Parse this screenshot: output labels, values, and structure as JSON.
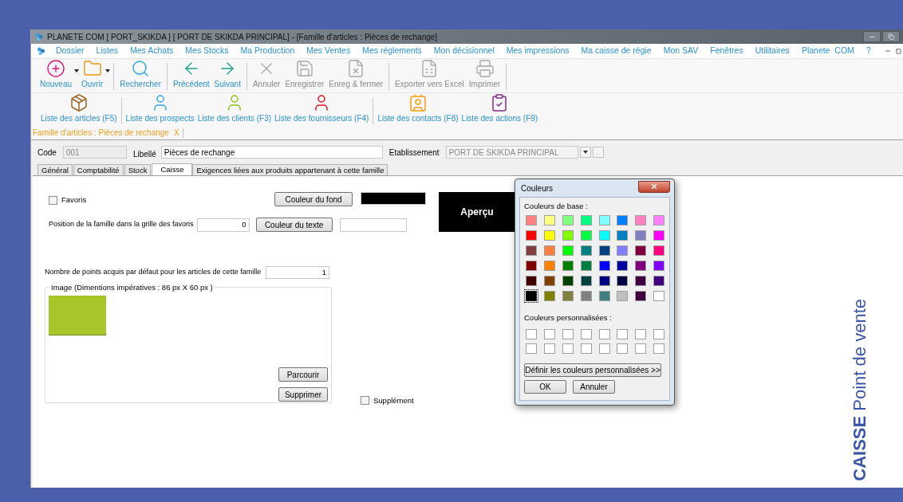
{
  "window": {
    "title": "PLANETE COM [ PORT_SKIKDA ] [ PORT DE SKIKDA PRINCIPAL] - [Famille d'articles : Pièces de rechange]"
  },
  "menu": [
    "Dossier",
    "Listes",
    "Mes Achats",
    "Mes Stocks",
    "Ma Production",
    "Mes Ventes",
    "Mes réglements",
    "Mon décisionnel",
    "Mes impressions",
    "Ma caisse de régie",
    "Mon SAV",
    "Fenêtres",
    "Utilitaires",
    "Planete  COM",
    "?"
  ],
  "toolbar": [
    {
      "label": "Nouveau",
      "disabled": false,
      "dropdown": true
    },
    {
      "label": "Ouvrir",
      "disabled": false,
      "dropdown": true
    },
    {
      "label": "Rechercher",
      "disabled": false,
      "dropdown": false
    },
    {
      "label": "Précédent",
      "disabled": false,
      "dropdown": false
    },
    {
      "label": "Suivant",
      "disabled": false,
      "dropdown": false
    },
    {
      "label": "Annuler",
      "disabled": true,
      "dropdown": false
    },
    {
      "label": "Enregistrer",
      "disabled": true,
      "dropdown": false
    },
    {
      "label": "Enreg & fermer",
      "disabled": true,
      "dropdown": false
    },
    {
      "label": "Exporter vers Excel",
      "disabled": true,
      "dropdown": false
    },
    {
      "label": "Imprimer",
      "disabled": true,
      "dropdown": false
    }
  ],
  "quick_links": [
    "Liste des articles (F5)",
    "Liste des prospects",
    "Liste des clients (F3)",
    "Liste des fournisseurs (F4)",
    "Liste des contacts (F8)",
    "Liste des actions (F9)"
  ],
  "document_tab": {
    "label": "Famille d'articles : Pièces de rechange",
    "close": "X"
  },
  "header": {
    "code": {
      "label": "Code",
      "value": "001",
      "disabled": true
    },
    "libelle": {
      "label": "Libellé",
      "value": "Pièces de rechange"
    },
    "etablissement": {
      "label": "Etablissement",
      "value": "PORT DE SKIKDA PRINCIPAL",
      "disabled": true,
      "browse": ".."
    }
  },
  "tabs": [
    {
      "label": "Général",
      "selected": false
    },
    {
      "label": "Comptabilité",
      "selected": false
    },
    {
      "label": "Stock",
      "selected": false
    },
    {
      "label": "Caisse",
      "selected": true
    },
    {
      "label": "Exigences liées aux produits appartenant à cette famille",
      "selected": false
    }
  ],
  "caisse": {
    "favoris": {
      "label": "Favoris",
      "checked": false
    },
    "position": {
      "label": "Position de la famille dans la grille des favoris",
      "value": "0"
    },
    "background": {
      "button": "Couleur du fond",
      "color": "#000000"
    },
    "text": {
      "button": "Couleur du texte",
      "color": "#ffffff"
    },
    "preview": "Aperçu",
    "points": {
      "label": "Nombre de points acquis par défaut pour les articles de cette famille",
      "value": "1"
    },
    "image": {
      "title": "Image (Dimentions impératives : 86 px X 60 px )",
      "color": "#a8c62a",
      "browse": "Parcourir",
      "delete": "Supprimer"
    },
    "supplement": {
      "label": "Supplément",
      "checked": false
    }
  },
  "color_dialog": {
    "title": "Couleurs",
    "basic_label": "Couleurs de base :",
    "basic_colors": [
      {
        "color": "#ff8080",
        "selected": false
      },
      {
        "color": "#ffff80",
        "selected": false
      },
      {
        "color": "#80ff80",
        "selected": false
      },
      {
        "color": "#00ff80",
        "selected": false
      },
      {
        "color": "#80ffff",
        "selected": false
      },
      {
        "color": "#0080ff",
        "selected": false
      },
      {
        "color": "#ff80c0",
        "selected": false
      },
      {
        "color": "#ff80ff",
        "selected": false
      },
      {
        "color": "#ff0000",
        "selected": false
      },
      {
        "color": "#ffff00",
        "selected": false
      },
      {
        "color": "#80ff00",
        "selected": false
      },
      {
        "color": "#00ff40",
        "selected": false
      },
      {
        "color": "#00ffff",
        "selected": false
      },
      {
        "color": "#0080c0",
        "selected": false
      },
      {
        "color": "#8080c0",
        "selected": false
      },
      {
        "color": "#ff00ff",
        "selected": false
      },
      {
        "color": "#804040",
        "selected": false
      },
      {
        "color": "#ff8040",
        "selected": false
      },
      {
        "color": "#00ff00",
        "selected": false
      },
      {
        "color": "#008080",
        "selected": false
      },
      {
        "color": "#004080",
        "selected": false
      },
      {
        "color": "#8080ff",
        "selected": false
      },
      {
        "color": "#800040",
        "selected": false
      },
      {
        "color": "#ff0080",
        "selected": false
      },
      {
        "color": "#800000",
        "selected": false
      },
      {
        "color": "#ff8000",
        "selected": false
      },
      {
        "color": "#008000",
        "selected": false
      },
      {
        "color": "#008040",
        "selected": false
      },
      {
        "color": "#0000ff",
        "selected": false
      },
      {
        "color": "#0000a0",
        "selected": false
      },
      {
        "color": "#800080",
        "selected": false
      },
      {
        "color": "#8000ff",
        "selected": false
      },
      {
        "color": "#400000",
        "selected": false
      },
      {
        "color": "#804000",
        "selected": false
      },
      {
        "color": "#004000",
        "selected": false
      },
      {
        "color": "#004040",
        "selected": false
      },
      {
        "color": "#000080",
        "selected": false
      },
      {
        "color": "#000040",
        "selected": false
      },
      {
        "color": "#400040",
        "selected": false
      },
      {
        "color": "#400080",
        "selected": false
      },
      {
        "color": "#000000",
        "selected": true
      },
      {
        "color": "#808000",
        "selected": false
      },
      {
        "color": "#808040",
        "selected": false
      },
      {
        "color": "#808080",
        "selected": false
      },
      {
        "color": "#408080",
        "selected": false
      },
      {
        "color": "#c0c0c0",
        "selected": false
      },
      {
        "color": "#400040",
        "selected": false
      },
      {
        "color": "#ffffff",
        "selected": false
      }
    ],
    "custom_label": "Couleurs personnalisées :",
    "custom_colors": [
      {
        "color": "#ffffff"
      },
      {
        "color": "#ffffff"
      },
      {
        "color": "#ffffff"
      },
      {
        "color": "#ffffff"
      },
      {
        "color": "#ffffff"
      },
      {
        "color": "#ffffff"
      },
      {
        "color": "#ffffff"
      },
      {
        "color": "#ffffff"
      },
      {
        "color": "#ffffff"
      },
      {
        "color": "#ffffff"
      },
      {
        "color": "#ffffff"
      },
      {
        "color": "#ffffff"
      },
      {
        "color": "#ffffff"
      },
      {
        "color": "#ffffff"
      },
      {
        "color": "#ffffff"
      },
      {
        "color": "#ffffff"
      }
    ],
    "define_button": "Définir les couleurs personnalisées >>",
    "ok": "OK",
    "cancel": "Annuler"
  },
  "caption": {
    "bold": "CAISSE",
    "text": "Point de vente"
  }
}
